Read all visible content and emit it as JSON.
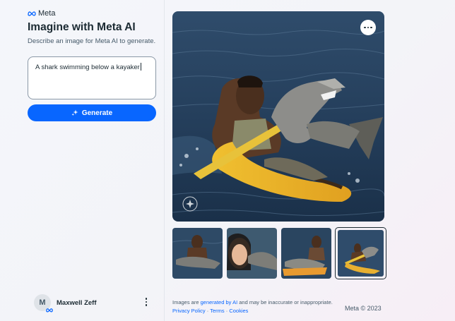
{
  "brand": {
    "logo_text": "Meta"
  },
  "panel": {
    "title": "Imagine with Meta AI",
    "subtitle": "Describe an image for Meta AI to generate.",
    "prompt_value": "A shark swimming below a kayaker",
    "generate_label": "Generate"
  },
  "user": {
    "initial": "M",
    "name": "Maxwell Zeff"
  },
  "footer": {
    "disclaimer_pre": "Images are ",
    "disclaimer_link": "generated by AI",
    "disclaimer_post": " and may be inaccurate or inappropriate.",
    "privacy": "Privacy Policy",
    "sep1": " · ",
    "terms": "Terms",
    "sep2": " · ",
    "cookies": "Cookies",
    "copyright": "Meta © 2023"
  },
  "colors": {
    "accent": "#0866ff",
    "text": "#1c2b33",
    "muted": "#465a69"
  },
  "icons": [
    "meta-logo-icon",
    "sparkle-icon",
    "more-options-icon",
    "kebab-menu-icon",
    "meta-badge-icon",
    "watermark-icon"
  ]
}
